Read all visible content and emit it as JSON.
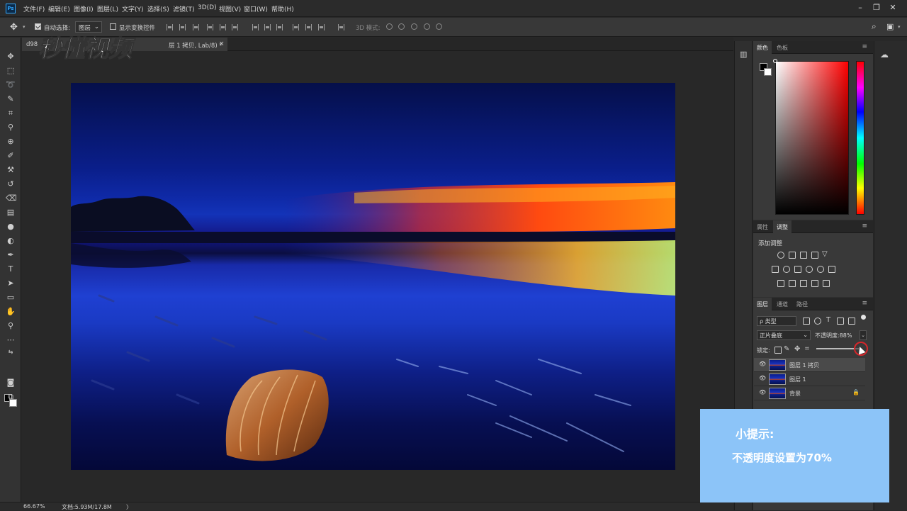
{
  "app": {
    "logo": "Ps"
  },
  "menu": [
    "文件(F)",
    "编辑(E)",
    "图像(I)",
    "图层(L)",
    "文字(Y)",
    "选择(S)",
    "滤镜(T)",
    "3D(D)",
    "视图(V)",
    "窗口(W)",
    "帮助(H)"
  ],
  "options": {
    "auto_select_label": "自动选择:",
    "auto_select_value": "图层",
    "show_transform_label": "显示变换控件",
    "mode_3d_label": "3D 模式:"
  },
  "document": {
    "tab_prefix": "d98",
    "tab_title": "层 1 拷贝, Lab/8) *",
    "close_glyph": "×"
  },
  "watermark": {
    "text": "秒懂视频"
  },
  "status": {
    "zoom": "66.67%",
    "doc_info": "文档:5.93M/17.8M",
    "arrow": "〉"
  },
  "panels": {
    "color_tabs": [
      "颜色",
      "色板"
    ],
    "adjust_tabs": [
      "属性",
      "调整"
    ],
    "add_adjustment_label": "添加调整",
    "layers_tabs": [
      "图层",
      "通道",
      "路径"
    ],
    "filter_kind": "ρ 类型",
    "blend_mode": "正片叠底",
    "opacity_label": "不透明度:",
    "opacity_value": "88%",
    "opacity_fraction": 0.88,
    "lock_label": "锁定:",
    "menu_glyph": "≡"
  },
  "layers": [
    {
      "name": "图层 1 拷贝",
      "selected": true,
      "locked": false
    },
    {
      "name": "图层 1",
      "selected": false,
      "locked": false
    },
    {
      "name": "背景",
      "selected": false,
      "locked": true
    }
  ],
  "tip": {
    "title": "小提示:",
    "text": "不透明度设置为70%"
  },
  "colors": {
    "accent": "#31a8ff",
    "tip_bg": "#8cc4f8",
    "highlight": "#d6262b"
  }
}
